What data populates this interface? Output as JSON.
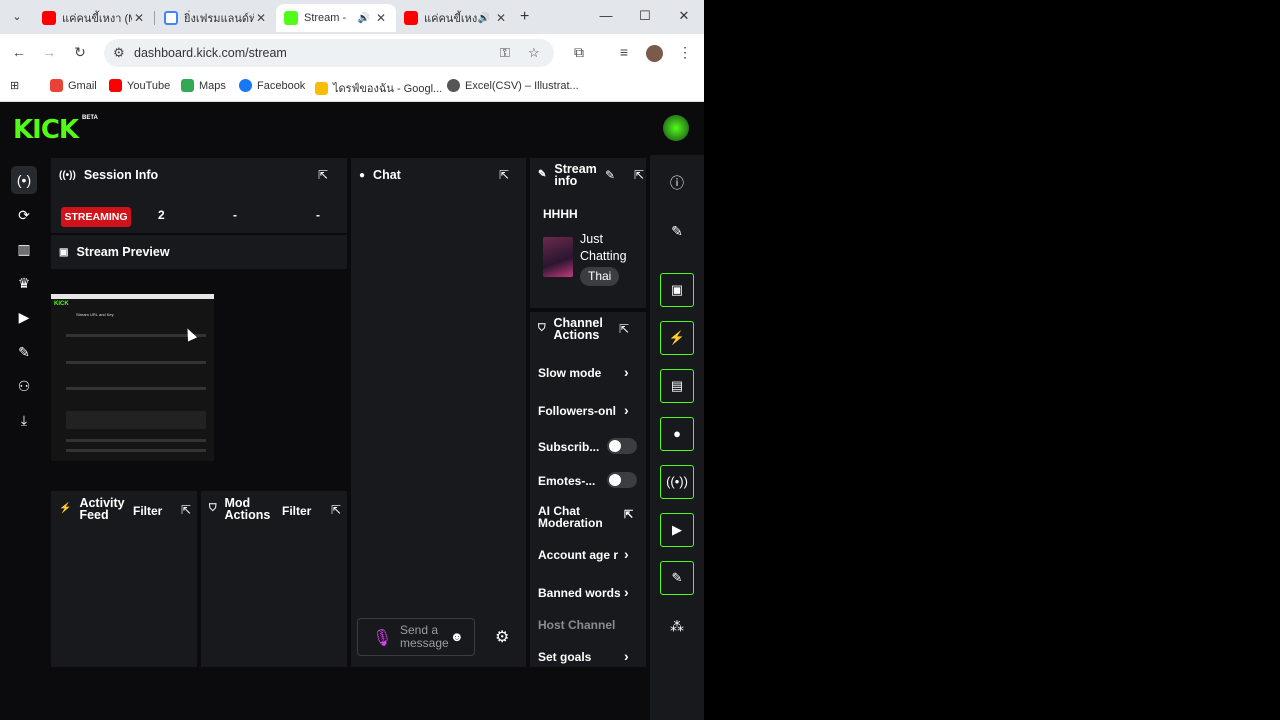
{
  "browser": {
    "tabs": [
      {
        "title": "แค่คนขี้เหงา (M",
        "favicon_color": "#ff0000",
        "active": false,
        "audio": false
      },
      {
        "title": "ยิ่งเฟรมแลนด์ทำ",
        "favicon_color": "#4285f4",
        "active": false,
        "audio": false
      },
      {
        "title": "Stream -",
        "favicon_color": "#53fc18",
        "active": true,
        "audio": true
      },
      {
        "title": "แค่คนขี้เหงา",
        "favicon_color": "#ff0000",
        "active": false,
        "audio": true
      }
    ],
    "url": "dashboard.kick.com/stream",
    "bookmarks": [
      {
        "label": "Gmail",
        "icon_color": "#ea4335"
      },
      {
        "label": "YouTube",
        "icon_color": "#ff0000"
      },
      {
        "label": "Maps",
        "icon_color": "#34a853"
      },
      {
        "label": "Facebook",
        "icon_color": "#1877f2"
      },
      {
        "label": "ไดรฟ์ของฉัน - Googl...",
        "icon_color": "#fbbc04"
      },
      {
        "label": "Excel(CSV) – Illustrat...",
        "icon_color": "#555555"
      }
    ]
  },
  "kick": {
    "logo": "KICK",
    "beta": "BETA",
    "accent": "#53fc18",
    "session_info": {
      "title": "Session Info",
      "status": "STREAMING",
      "viewers": "2",
      "stat2": "-",
      "stat3": "-"
    },
    "stream_preview": {
      "title": "Stream Preview"
    },
    "chat": {
      "title": "Chat",
      "placeholder_line1": "Send a",
      "placeholder_line2": "message"
    },
    "stream_info": {
      "title_line1": "Stream",
      "title_line2": "info",
      "stream_title": "HHHH",
      "category_line1": "Just",
      "category_line2": "Chatting",
      "language": "Thai"
    },
    "channel_actions": {
      "title_line1": "Channel",
      "title_line2": "Actions",
      "items": [
        {
          "label": "Slow mode"
        },
        {
          "label": "Followers-onl"
        },
        {
          "label": "Subscrib..."
        },
        {
          "label": "Emotes-..."
        },
        {
          "label_line1": "AI Chat",
          "label_line2": "Moderation"
        },
        {
          "label": "Account age r"
        },
        {
          "label": "Banned words"
        },
        {
          "label": "Host Channel"
        },
        {
          "label": "Set goals"
        }
      ],
      "toggles": {
        "subscribers_only": false,
        "emotes_only": false
      }
    },
    "activity_feed": {
      "title_line1": "Activity",
      "title_line2": "Feed",
      "filter": "Filter"
    },
    "mod_actions": {
      "title_line1": "Mod",
      "title_line2": "Actions",
      "filter": "Filter"
    }
  }
}
